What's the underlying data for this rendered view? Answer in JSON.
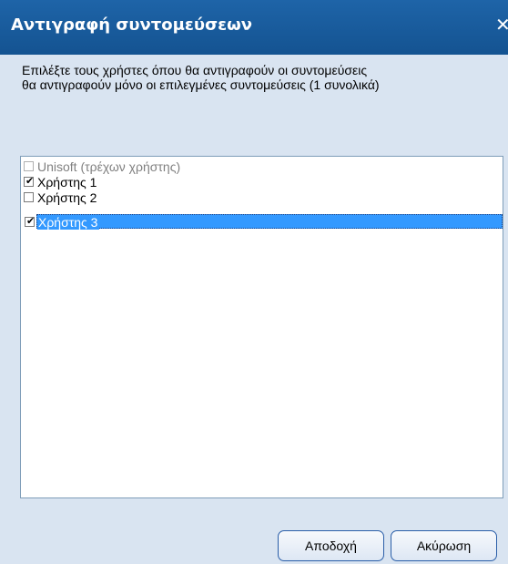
{
  "dialog": {
    "title": "Αντιγραφή συντομεύσεων",
    "close_glyph": "✕",
    "message_line1": "Επιλέξτε τους χρήστες όπου θα αντιγραφούν οι συντομεύσεις",
    "message_line2": "θα αντιγραφούν μόνο οι επιλεγμένες συντομεύσεις (1 συνολικά)"
  },
  "users": {
    "items": [
      {
        "label": "Unisoft (τρέχων χρήστης)",
        "checked": false,
        "disabled": true,
        "selected": false
      },
      {
        "label": "Χρήστης 1",
        "checked": true,
        "disabled": false,
        "selected": false
      },
      {
        "label": "Χρήστης 2",
        "checked": false,
        "disabled": false,
        "selected": false
      },
      {
        "label": "Χρήστης 3",
        "checked": true,
        "disabled": false,
        "selected": true
      }
    ]
  },
  "buttons": {
    "ok_label": "Αποδοχή",
    "cancel_label": "Ακύρωση"
  },
  "icons": {
    "close": "close-icon",
    "check": "checkmark-icon"
  },
  "colors": {
    "titlebar": "#145391",
    "dialog_bg": "#d9e4f1",
    "selection": "#3399ff",
    "button_border": "#2a5ea8"
  }
}
